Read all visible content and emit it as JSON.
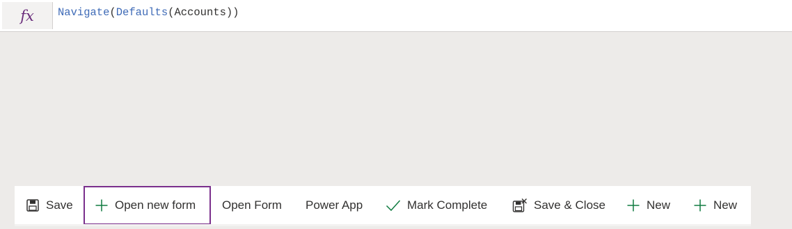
{
  "formula_bar": {
    "fx_label": "fx",
    "formula": {
      "fn1": "Navigate",
      "p1": "(",
      "fn2": "Defaults",
      "p2": "(Accounts))"
    }
  },
  "command_bar": {
    "items": [
      {
        "label": "Save",
        "icon": "save-icon"
      },
      {
        "label": "Open new form",
        "icon": "plus-icon",
        "selected": true
      },
      {
        "label": "Open Form"
      },
      {
        "label": "Power App"
      },
      {
        "label": "Mark Complete",
        "icon": "checkmark-icon"
      },
      {
        "label": "Save & Close",
        "icon": "save-close-icon"
      },
      {
        "label": "New",
        "icon": "plus-icon"
      },
      {
        "label": "New",
        "icon": "plus-icon"
      }
    ]
  },
  "colors": {
    "canvas_background": "#edebe9",
    "selection_border": "#7a2f8c",
    "icon_green": "#107c41",
    "formula_function": "#3f6bb7",
    "fx_purple": "#6b2e7c"
  }
}
